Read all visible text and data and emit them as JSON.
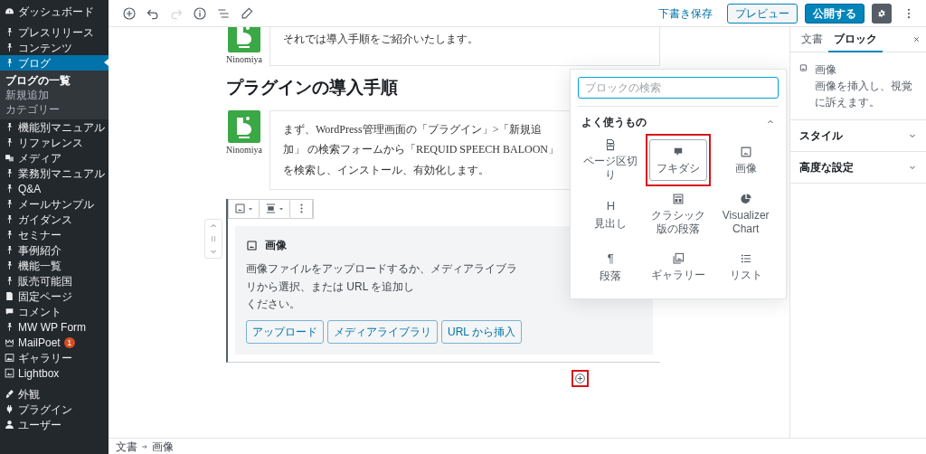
{
  "sidebar": {
    "sections": [
      [
        {
          "label": "ダッシュボード",
          "selected": false
        }
      ],
      [
        {
          "label": "プレスリリース",
          "selected": false
        },
        {
          "label": "コンテンツ",
          "selected": false
        },
        {
          "label": "ブログ",
          "selected": true,
          "children": [
            {
              "label": "ブログの一覧",
              "selected": true
            },
            {
              "label": "新規追加",
              "selected": false
            },
            {
              "label": "カテゴリー",
              "selected": false
            }
          ]
        },
        {
          "label": "機能別マニュアル",
          "selected": false
        },
        {
          "label": "リファレンス",
          "selected": false
        },
        {
          "label": "メディア",
          "selected": false
        },
        {
          "label": "業務別マニュアル",
          "selected": false
        },
        {
          "label": "Q&A",
          "selected": false
        },
        {
          "label": "メールサンプル",
          "selected": false
        },
        {
          "label": "ガイダンス",
          "selected": false
        },
        {
          "label": "セミナー",
          "selected": false
        },
        {
          "label": "事例紹介",
          "selected": false
        },
        {
          "label": "機能一覧",
          "selected": false
        },
        {
          "label": "販売可能国",
          "selected": false
        },
        {
          "label": "固定ページ",
          "selected": false
        },
        {
          "label": "コメント",
          "selected": false
        },
        {
          "label": "MW WP Form",
          "selected": false
        },
        {
          "label": "MailPoet",
          "selected": false,
          "badge": "1"
        },
        {
          "label": "ギャラリー",
          "selected": false
        },
        {
          "label": "Lightbox",
          "selected": false
        }
      ],
      [
        {
          "label": "外観",
          "selected": false
        },
        {
          "label": "プラグイン",
          "selected": false
        },
        {
          "label": "ユーザー",
          "selected": false
        }
      ]
    ]
  },
  "toolbar": {
    "tools": [
      {
        "disabled": false
      },
      {
        "disabled": false
      },
      {
        "disabled": true
      },
      {
        "disabled": false
      },
      {
        "disabled": false
      },
      {
        "disabled": false
      }
    ],
    "save_draft": "下書き保存",
    "preview": "プレビュー",
    "publish": "公開する",
    "settings_open": true
  },
  "blocks": [
    {
      "kind": "balloon",
      "name": "Ninomiya",
      "lines": [
        "それでは導入手順をご紹介いたします。"
      ]
    },
    {
      "kind": "heading",
      "text": "プラグインの導入手順"
    },
    {
      "kind": "balloon",
      "name": "Ninomiya",
      "lines": [
        "まず、WordPress管理画面の「プラグイン」>「新規追",
        "加」 の検索フォームから「REQUID SPEECH BALOON」",
        "を検索し、インストール、有効化します。"
      ]
    },
    {
      "kind": "image",
      "title": "画像",
      "lines": [
        "画像ファイルをアップロードするか、メディアライブラリから選択、または URL を追加し",
        "ください。"
      ],
      "buttons": [
        "アップロード",
        "メディアライブラリ",
        "URL から挿入"
      ]
    }
  ],
  "inserter": {
    "search": {
      "placeholder": "ブロックの検索"
    },
    "section": {
      "title": "よく使うもの",
      "expanded": true
    },
    "items": [
      {
        "label": "ページ区切り",
        "selected": false,
        "highlighted": false
      },
      {
        "label": "フキダシ",
        "selected": true,
        "highlighted": true
      },
      {
        "label": "画像",
        "selected": false,
        "highlighted": false
      },
      {
        "label": "見出し",
        "glyph": "H",
        "selected": false,
        "highlighted": false
      },
      {
        "label": "クラシック版の段落",
        "selected": false,
        "highlighted": false
      },
      {
        "label": "Visualizer Chart",
        "selected": false,
        "highlighted": false
      },
      {
        "label": "段落",
        "glyph": "¶",
        "selected": false,
        "highlighted": false
      },
      {
        "label": "ギャラリー",
        "selected": false,
        "highlighted": false
      },
      {
        "label": "リスト",
        "selected": false,
        "highlighted": false
      }
    ]
  },
  "inserter_button": {
    "highlighted": true
  },
  "settings": {
    "tabs": [
      {
        "label": "文書",
        "selected": false
      },
      {
        "label": "ブロック",
        "selected": true
      }
    ],
    "block": {
      "title": "画像",
      "description": "画像を挿入し、視覚に訴えます。"
    },
    "panels": [
      {
        "title": "スタイル",
        "expanded": false
      },
      {
        "title": "高度な設定",
        "expanded": false
      }
    ]
  },
  "breadcrumb": [
    "文書",
    "画像"
  ]
}
